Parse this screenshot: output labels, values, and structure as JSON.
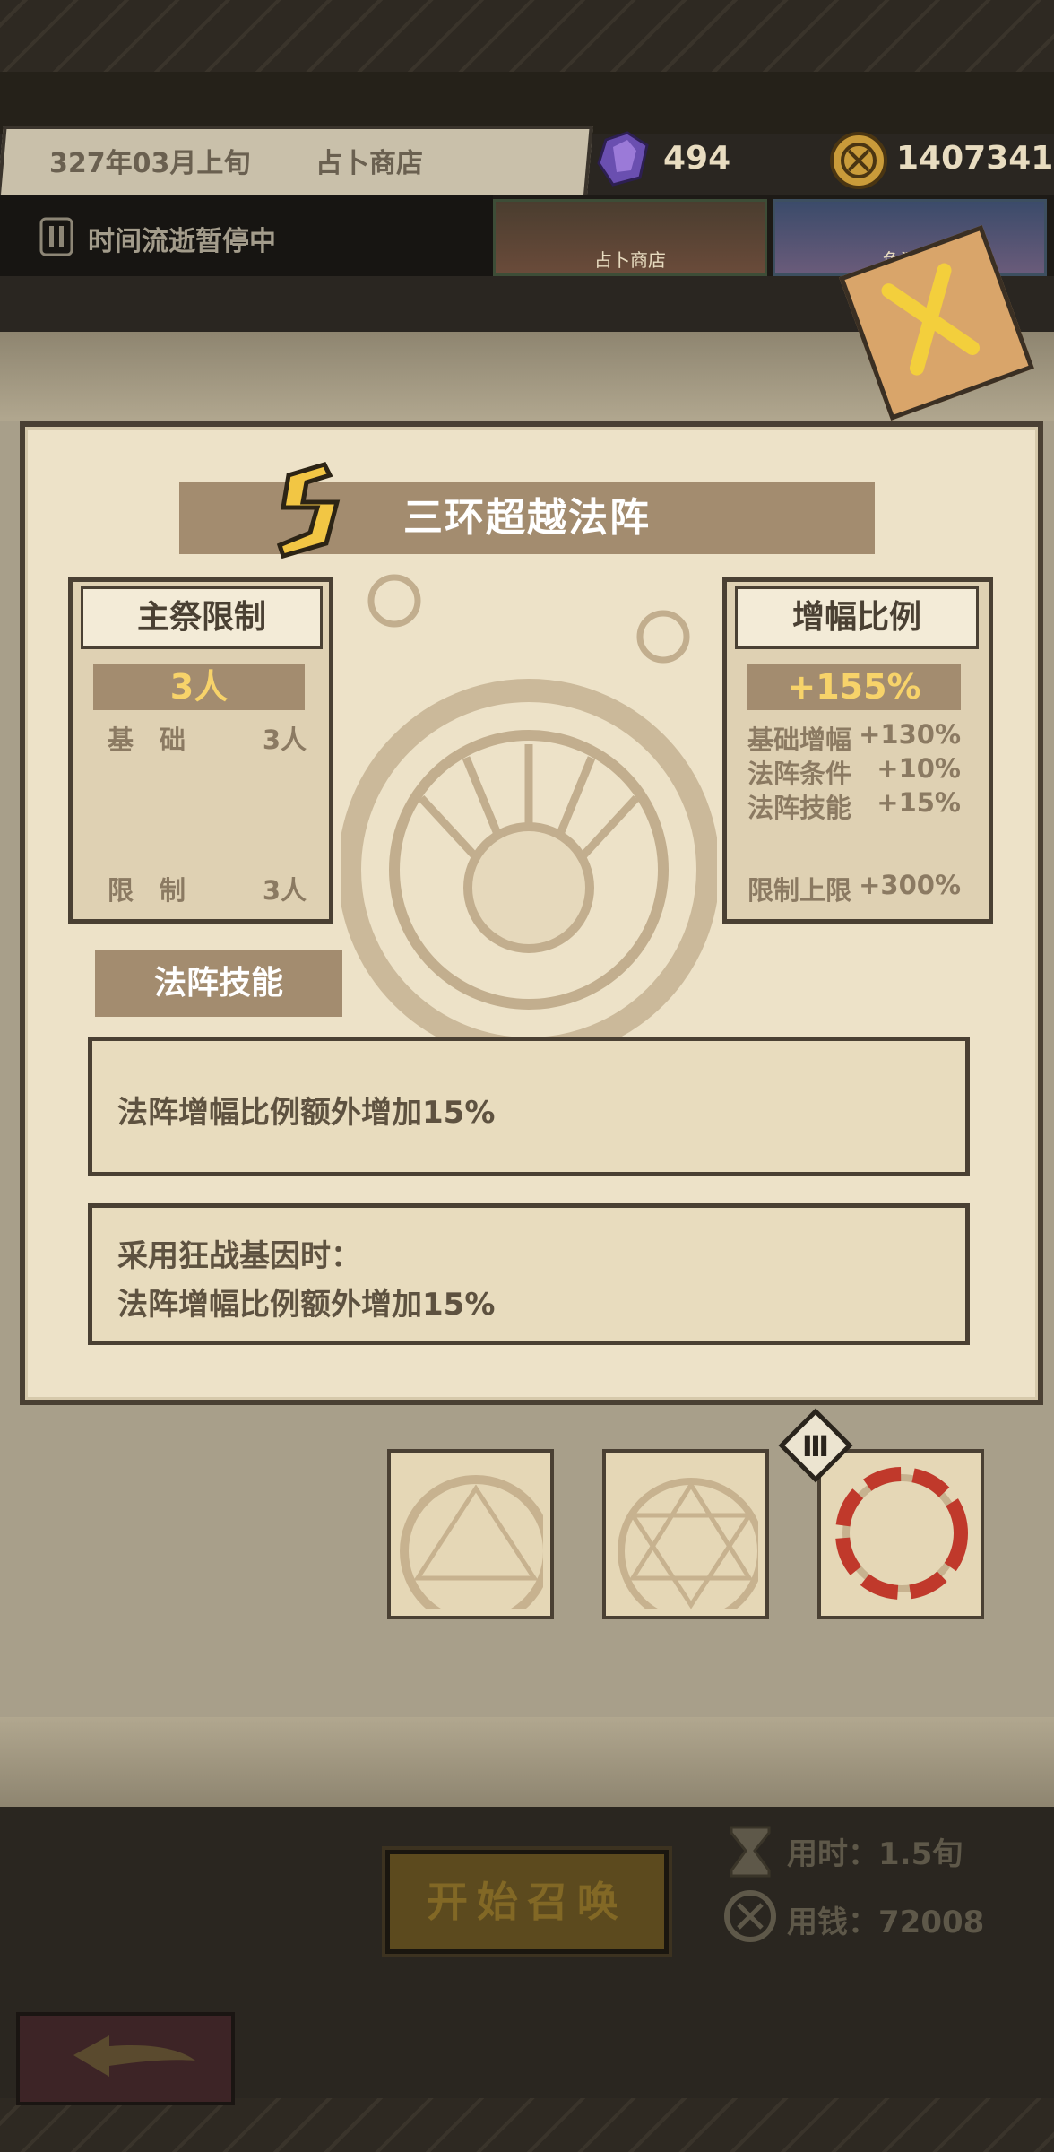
{
  "header": {
    "date": "327年03月上旬",
    "location": "占卜商店",
    "crystals": "494",
    "coins": "1407341",
    "pause_text": "时间流逝暂停中",
    "shop_cards": [
      "占卜商店",
      "兔酒馆"
    ]
  },
  "dialog": {
    "title": "三环超越法阵",
    "rank": "S",
    "left_panel": {
      "heading": "主祭限制",
      "value": "3人",
      "rows": [
        {
          "label": "基　础",
          "value": "3人"
        }
      ],
      "footer": {
        "label": "限　制",
        "value": "3人"
      }
    },
    "right_panel": {
      "heading": "增幅比例",
      "value": "+155%",
      "rows": [
        {
          "label": "基础增幅",
          "value": "+130%"
        },
        {
          "label": "法阵条件",
          "value": "+10%"
        },
        {
          "label": "法阵技能",
          "value": "+15%"
        }
      ],
      "footer": {
        "label": "限制上限",
        "value": "+300%"
      }
    },
    "skill_tab": "法阵技能",
    "skills": [
      {
        "lines": [
          "法阵增幅比例额外增加15%"
        ]
      },
      {
        "lines": [
          "采用狂战基因时：",
          "法阵增幅比例额外增加15%"
        ]
      }
    ]
  },
  "actions": {
    "start_label": "开始召唤",
    "time_cost": "用时：1.5旬",
    "money_cost": "用钱：72008"
  }
}
